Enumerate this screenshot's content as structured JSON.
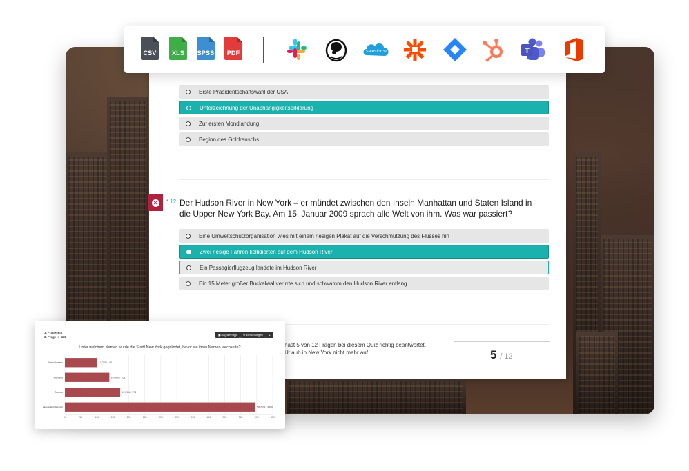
{
  "toolbar": {
    "exports": [
      {
        "label": "CSV",
        "color": "#4a4f5a"
      },
      {
        "label": "XLS",
        "color": "#3fae49"
      },
      {
        "label": "SPSS",
        "color": "#3d8fd1"
      },
      {
        "label": "PDF",
        "color": "#e23b3b"
      }
    ],
    "apps": [
      "slack-icon",
      "mailchimp-icon",
      "salesforce-icon",
      "zapier-icon",
      "jira-icon",
      "hubspot-icon",
      "teams-icon",
      "office-icon"
    ],
    "salesforce_label": "salesforce"
  },
  "quiz": {
    "previous_options": [
      {
        "text": "Erste Präsidentschaftswahl der USA",
        "state": "normal"
      },
      {
        "text": "Unterzeichnung der Unabhängigkeitserklärung",
        "state": "selected"
      },
      {
        "text": "Zur ersten Mondlandung",
        "state": "normal"
      },
      {
        "text": "Beginn des Goldrauschs",
        "state": "normal"
      }
    ],
    "question": {
      "number": "12",
      "marker": "*",
      "text": "Der Hudson River in New York – er mündet zwischen den Inseln Manhattan und Staten Island in die Upper New York Bay. Am 15. Januar 2009 sprach alle Welt von ihm. Was war passiert?",
      "options": [
        {
          "text": "Eine Umweltschutzorganisation wies mit einem riesigen Plakat auf die Verschmutzung des Flusses hin",
          "state": "normal"
        },
        {
          "text": "Zwei riesige Fähren kollidierten auf dem Hudson River",
          "state": "selected"
        },
        {
          "text": "Ein Passagierflugzeug landete im Hudson River",
          "state": "correct"
        },
        {
          "text": "Ein 15 Meter großer Buckelwal verirrte sich und schwamm den Hudson River entlang",
          "state": "normal"
        }
      ]
    },
    "result_line1": "hast 5 von 12 Fragen bei diesem Quiz richtig beantwortet.",
    "result_line2": "Urlaub in New York nicht mehr auf.",
    "score": "5",
    "score_total": "/ 12"
  },
  "chart_card": {
    "meta_line1": "1. Fragesets",
    "meta_line2": "3. Frage",
    "meta_count": "438",
    "btn_diagram": "Diagrammtyp",
    "btn_settings": "Einstellungen",
    "btn_download": "⇣",
    "colors": {
      "bar": "#a84a4d",
      "grid": "#e6e6e6"
    }
  },
  "chart_data": {
    "type": "bar",
    "orientation": "horizontal",
    "title": "Unter welchem Namen wurde die Stadt New York gegründet, bevor sie ihren Namen wechselte?",
    "categories": [
      "New Orleans",
      "Portland",
      "Toronto",
      "Nieuw Amsterdam"
    ],
    "values": [
      101,
      139,
      173,
      596
    ],
    "data_labels": [
      "10,27% / 45",
      "14,69% / 161",
      "17,39% / 176",
      "58,70% / 3380"
    ],
    "xlim": [
      0,
      650
    ],
    "xticks": [
      "0",
      "50",
      "100",
      "150",
      "200",
      "250",
      "300",
      "350",
      "400",
      "450",
      "500",
      "550",
      "600",
      "650"
    ],
    "grid": true
  }
}
